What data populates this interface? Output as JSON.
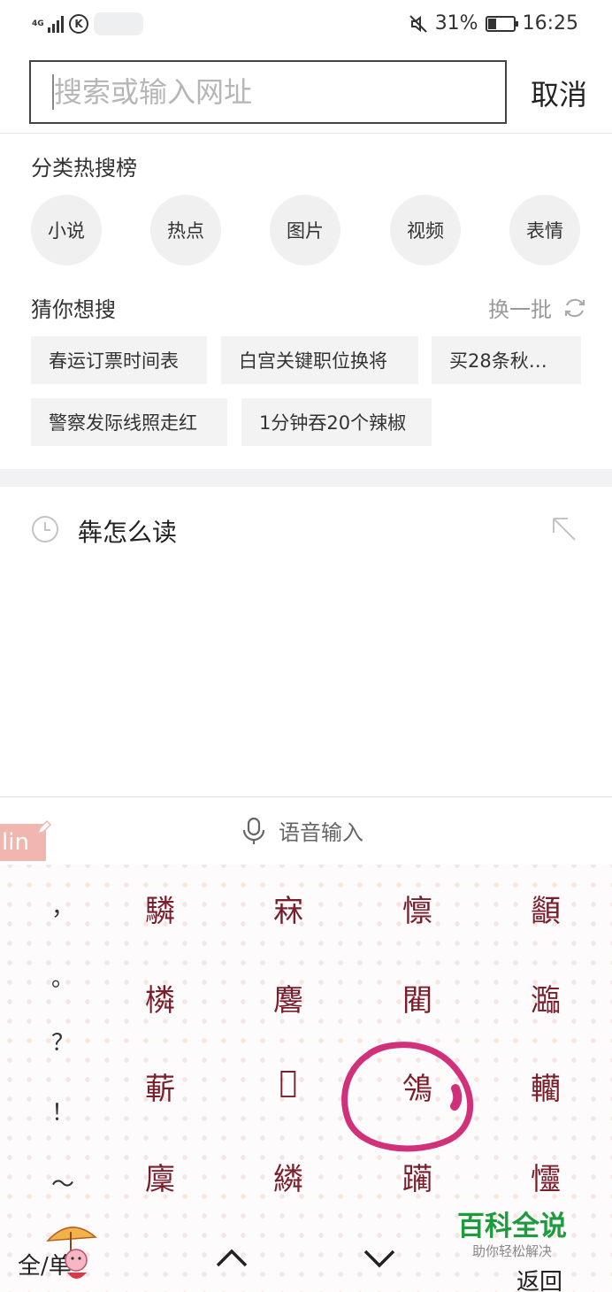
{
  "status_bar": {
    "network": "4G",
    "battery_percent": "31%",
    "battery_level": 0.31,
    "time": "16:25",
    "icons": [
      "signal-icon",
      "k-app-icon",
      "mute-icon",
      "battery-icon"
    ]
  },
  "search": {
    "placeholder": "搜索或输入网址",
    "cancel_label": "取消"
  },
  "categories": {
    "title": "分类热搜榜",
    "items": [
      "小说",
      "热点",
      "图片",
      "视频",
      "表情"
    ]
  },
  "suggestions": {
    "title": "猜你想搜",
    "refresh_label": "换一批",
    "tags": [
      "春运订票时间表",
      "白宫关键职位换将",
      "买28条秋…",
      "警察发际线照走红",
      "1分钟吞20个辣椒"
    ]
  },
  "history": {
    "items": [
      {
        "text": "犇怎么读",
        "icon": "clock-icon"
      }
    ]
  },
  "keyboard": {
    "voice_label": "语音输入",
    "pinyin_input": "lin",
    "punctuation": [
      "，",
      "。",
      "？",
      "！",
      "～"
    ],
    "candidates": [
      [
        "驎",
        "㝝",
        "懔",
        "顲"
      ],
      [
        "橉",
        "麐",
        "閵",
        "瀶"
      ],
      [
        "蔪",
        "𣜤",
        "鳹",
        "轥"
      ],
      [
        "廩",
        "繗",
        "躏",
        "㦭"
      ]
    ],
    "highlighted_candidate": "鳹",
    "highlight_color": "#d0317a",
    "lang_toggle": "全/单",
    "back_label": "返回"
  },
  "watermark": {
    "main": "百科全说",
    "sub": "助你轻松解决",
    "color": "#1e9b3c"
  }
}
